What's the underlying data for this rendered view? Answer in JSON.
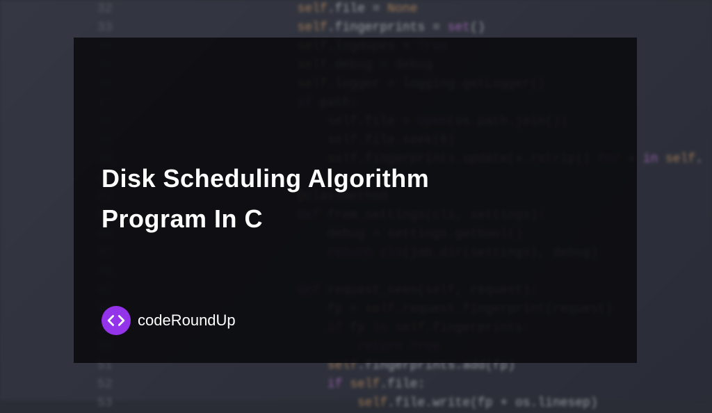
{
  "title": {
    "line1": "Disk Scheduling Algorithm",
    "line2": "Program In C"
  },
  "logo": {
    "text": "codeRoundUp"
  },
  "background_code": {
    "lines": [
      {
        "num": "32",
        "content": [
          {
            "t": "self",
            "c": "keyword-self"
          },
          {
            "t": ".file ",
            "c": "property"
          },
          {
            "t": "= ",
            "c": "operator"
          },
          {
            "t": "None",
            "c": "value-none"
          }
        ]
      },
      {
        "num": "33",
        "content": [
          {
            "t": "self",
            "c": "keyword-self"
          },
          {
            "t": ".fingerprints ",
            "c": "property"
          },
          {
            "t": "= ",
            "c": "operator"
          },
          {
            "t": "set",
            "c": "function-call"
          },
          {
            "t": "()",
            "c": "property"
          }
        ]
      },
      {
        "num": "34",
        "content": [
          {
            "t": "self",
            "c": "keyword-self"
          },
          {
            "t": ".logdupes ",
            "c": "property"
          },
          {
            "t": "= ",
            "c": "operator"
          },
          {
            "t": "True",
            "c": "value-true"
          }
        ]
      },
      {
        "num": "35",
        "content": [
          {
            "t": "self",
            "c": "keyword-self"
          },
          {
            "t": ".debug ",
            "c": "property"
          },
          {
            "t": "= debug",
            "c": "property"
          }
        ]
      },
      {
        "num": "36",
        "content": [
          {
            "t": "self",
            "c": "keyword-self"
          },
          {
            "t": ".logger ",
            "c": "property"
          },
          {
            "t": "= logging.getLogger",
            "c": "property"
          },
          {
            "t": "()",
            "c": "property"
          }
        ]
      },
      {
        "num": "37",
        "content": [
          {
            "t": "if ",
            "c": "keyword-if"
          },
          {
            "t": "path:",
            "c": "property"
          }
        ]
      },
      {
        "num": "38",
        "content": [
          {
            "t": "    self",
            "c": "keyword-self"
          },
          {
            "t": ".file ",
            "c": "property"
          },
          {
            "t": "= ",
            "c": "operator"
          },
          {
            "t": "open",
            "c": "function-call"
          },
          {
            "t": "(os.path.",
            "c": "property"
          },
          {
            "t": "join()",
            "c": "property"
          },
          {
            "t": ")",
            "c": "property"
          }
        ]
      },
      {
        "num": "39",
        "content": [
          {
            "t": "    self",
            "c": "keyword-self"
          },
          {
            "t": ".file.",
            "c": "property"
          },
          {
            "t": "seek",
            "c": "property"
          },
          {
            "t": "(0)",
            "c": "property"
          }
        ]
      },
      {
        "num": "40",
        "content": [
          {
            "t": "    self",
            "c": "keyword-self"
          },
          {
            "t": ".fingerprints.",
            "c": "property"
          },
          {
            "t": "update",
            "c": "property"
          },
          {
            "t": "(x.",
            "c": "property"
          },
          {
            "t": "rstrip",
            "c": "property"
          },
          {
            "t": "() ",
            "c": "property"
          },
          {
            "t": "for",
            "c": "keyword-for"
          },
          {
            "t": " x ",
            "c": "property"
          },
          {
            "t": "in",
            "c": "keyword-in"
          },
          {
            "t": " ",
            "c": "property"
          },
          {
            "t": "self",
            "c": "keyword-self"
          },
          {
            "t": ".",
            "c": "property"
          }
        ]
      },
      {
        "num": "41",
        "content": [
          {
            "t": "",
            "c": "property"
          }
        ]
      },
      {
        "num": "42",
        "content": [
          {
            "t": "@",
            "c": "keyword-orange"
          },
          {
            "t": "classmethod",
            "c": "property"
          }
        ]
      },
      {
        "num": "43",
        "content": [
          {
            "t": "def ",
            "c": "keyword-def"
          },
          {
            "t": "from_settings(cls, settings):",
            "c": "property"
          }
        ]
      },
      {
        "num": "44",
        "content": [
          {
            "t": "    debug ",
            "c": "property"
          },
          {
            "t": "= settings.",
            "c": "property"
          },
          {
            "t": "getbool",
            "c": "property"
          },
          {
            "t": "()",
            "c": "property"
          }
        ]
      },
      {
        "num": "45",
        "content": [
          {
            "t": "    return ",
            "c": "keyword-return"
          },
          {
            "t": "cls",
            "c": "function-call"
          },
          {
            "t": "(job_dir(settings), debug)",
            "c": "property"
          }
        ]
      },
      {
        "num": "46",
        "content": [
          {
            "t": "",
            "c": "property"
          }
        ]
      },
      {
        "num": "47",
        "content": [
          {
            "t": "def ",
            "c": "keyword-def"
          },
          {
            "t": "request_seen(",
            "c": "property"
          },
          {
            "t": "self",
            "c": "keyword-self"
          },
          {
            "t": ", request):",
            "c": "property"
          }
        ]
      },
      {
        "num": "48",
        "content": [
          {
            "t": "    fp ",
            "c": "property"
          },
          {
            "t": "= ",
            "c": "operator"
          },
          {
            "t": "self",
            "c": "keyword-self"
          },
          {
            "t": ".request_fingerprint(request)",
            "c": "property"
          }
        ]
      },
      {
        "num": "49",
        "content": [
          {
            "t": "    if ",
            "c": "keyword-if"
          },
          {
            "t": "fp ",
            "c": "property"
          },
          {
            "t": "in ",
            "c": "keyword-in"
          },
          {
            "t": "self",
            "c": "keyword-self"
          },
          {
            "t": ".fingerprints:",
            "c": "property"
          }
        ]
      },
      {
        "num": "50",
        "content": [
          {
            "t": "        return ",
            "c": "keyword-return"
          },
          {
            "t": "True",
            "c": "value-true"
          }
        ]
      },
      {
        "num": "51",
        "content": [
          {
            "t": "    self",
            "c": "keyword-self"
          },
          {
            "t": ".fingerprints.",
            "c": "property"
          },
          {
            "t": "add",
            "c": "property"
          },
          {
            "t": "(fp)",
            "c": "property"
          }
        ]
      },
      {
        "num": "52",
        "content": [
          {
            "t": "    if ",
            "c": "keyword-if"
          },
          {
            "t": "self",
            "c": "keyword-self"
          },
          {
            "t": ".file:",
            "c": "property"
          }
        ]
      },
      {
        "num": "53",
        "content": [
          {
            "t": "        self",
            "c": "keyword-self"
          },
          {
            "t": ".file.",
            "c": "property"
          },
          {
            "t": "write",
            "c": "property"
          },
          {
            "t": "(fp ",
            "c": "property"
          },
          {
            "t": "+ ",
            "c": "operator"
          },
          {
            "t": "os.linesep)",
            "c": "property"
          }
        ]
      }
    ]
  }
}
